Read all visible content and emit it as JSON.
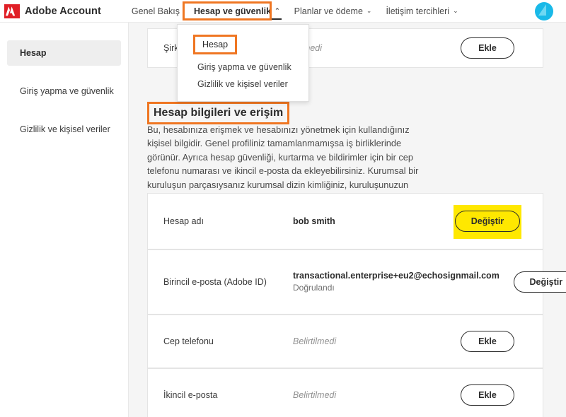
{
  "header": {
    "logo_icon": "adobe-logo-icon",
    "brand": "Adobe Account",
    "nav": [
      {
        "label": "Genel Bakış",
        "caret": "",
        "active": false
      },
      {
        "label": "Hesap ve güvenlik",
        "caret": "⌃",
        "active": true
      },
      {
        "label": "Planlar ve ödeme",
        "caret": "⌄",
        "active": false
      },
      {
        "label": "İletişim tercihleri",
        "caret": "⌄",
        "active": false
      }
    ],
    "avatar_icon": "user-avatar-icon"
  },
  "dropdown": {
    "items": [
      {
        "label": "Hesap",
        "highlighted": true
      },
      {
        "label": "Giriş yapma ve güvenlik",
        "highlighted": false
      },
      {
        "label": "Gizlilik ve kişisel veriler",
        "highlighted": false
      }
    ]
  },
  "sidebar": {
    "items": [
      {
        "label": "Hesap",
        "selected": true
      },
      {
        "label": "Giriş yapma ve güvenlik",
        "selected": false
      },
      {
        "label": "Gizlilik ve kişisel veriler",
        "selected": false
      }
    ]
  },
  "main": {
    "top_row": {
      "label": "Şirk",
      "value": "enmedi",
      "button": "Ekle"
    },
    "heading": "Hesap bilgileri ve erişim",
    "description": "Bu, hesabınıza erişmek ve hesabınızı yönetmek için kullandığınız kişisel bilgidir. Genel profiliniz tamamlanmamışsa iş birliklerinde görünür. Ayrıca hesap güvenliği, kurtarma ve bildirimler için bir cep telefonu numarası ve ikincil e-posta da ekleyebilirsiniz. Kurumsal bir kuruluşun parçasıysanız kurumsal dizin kimliğiniz, kuruluşunuzun diğer üyeleriyle iş birliği için kullanılabilir.",
    "rows": [
      {
        "label": "Hesap adı",
        "value": "bob smith",
        "value_muted": false,
        "sub": "",
        "button": "Değiştir",
        "highlighted": true
      },
      {
        "label": "Birincil e-posta (Adobe ID)",
        "value": "transactional.enterprise+eu2@echosignmail.com",
        "value_muted": false,
        "sub": "Doğrulandı",
        "button": "Değiştir",
        "highlighted": false
      },
      {
        "label": "Cep telefonu",
        "value": "Belirtilmedi",
        "value_muted": true,
        "sub": "",
        "button": "Ekle",
        "highlighted": false
      },
      {
        "label": "İkincil e-posta",
        "value": "Belirtilmedi",
        "value_muted": true,
        "sub": "",
        "button": "Ekle",
        "highlighted": false
      }
    ]
  },
  "colors": {
    "adobe_red": "#e01f26",
    "annotation_orange": "#ef7622",
    "highlight_yellow": "#ffe800",
    "avatar_cyan": "#19b9e8"
  }
}
